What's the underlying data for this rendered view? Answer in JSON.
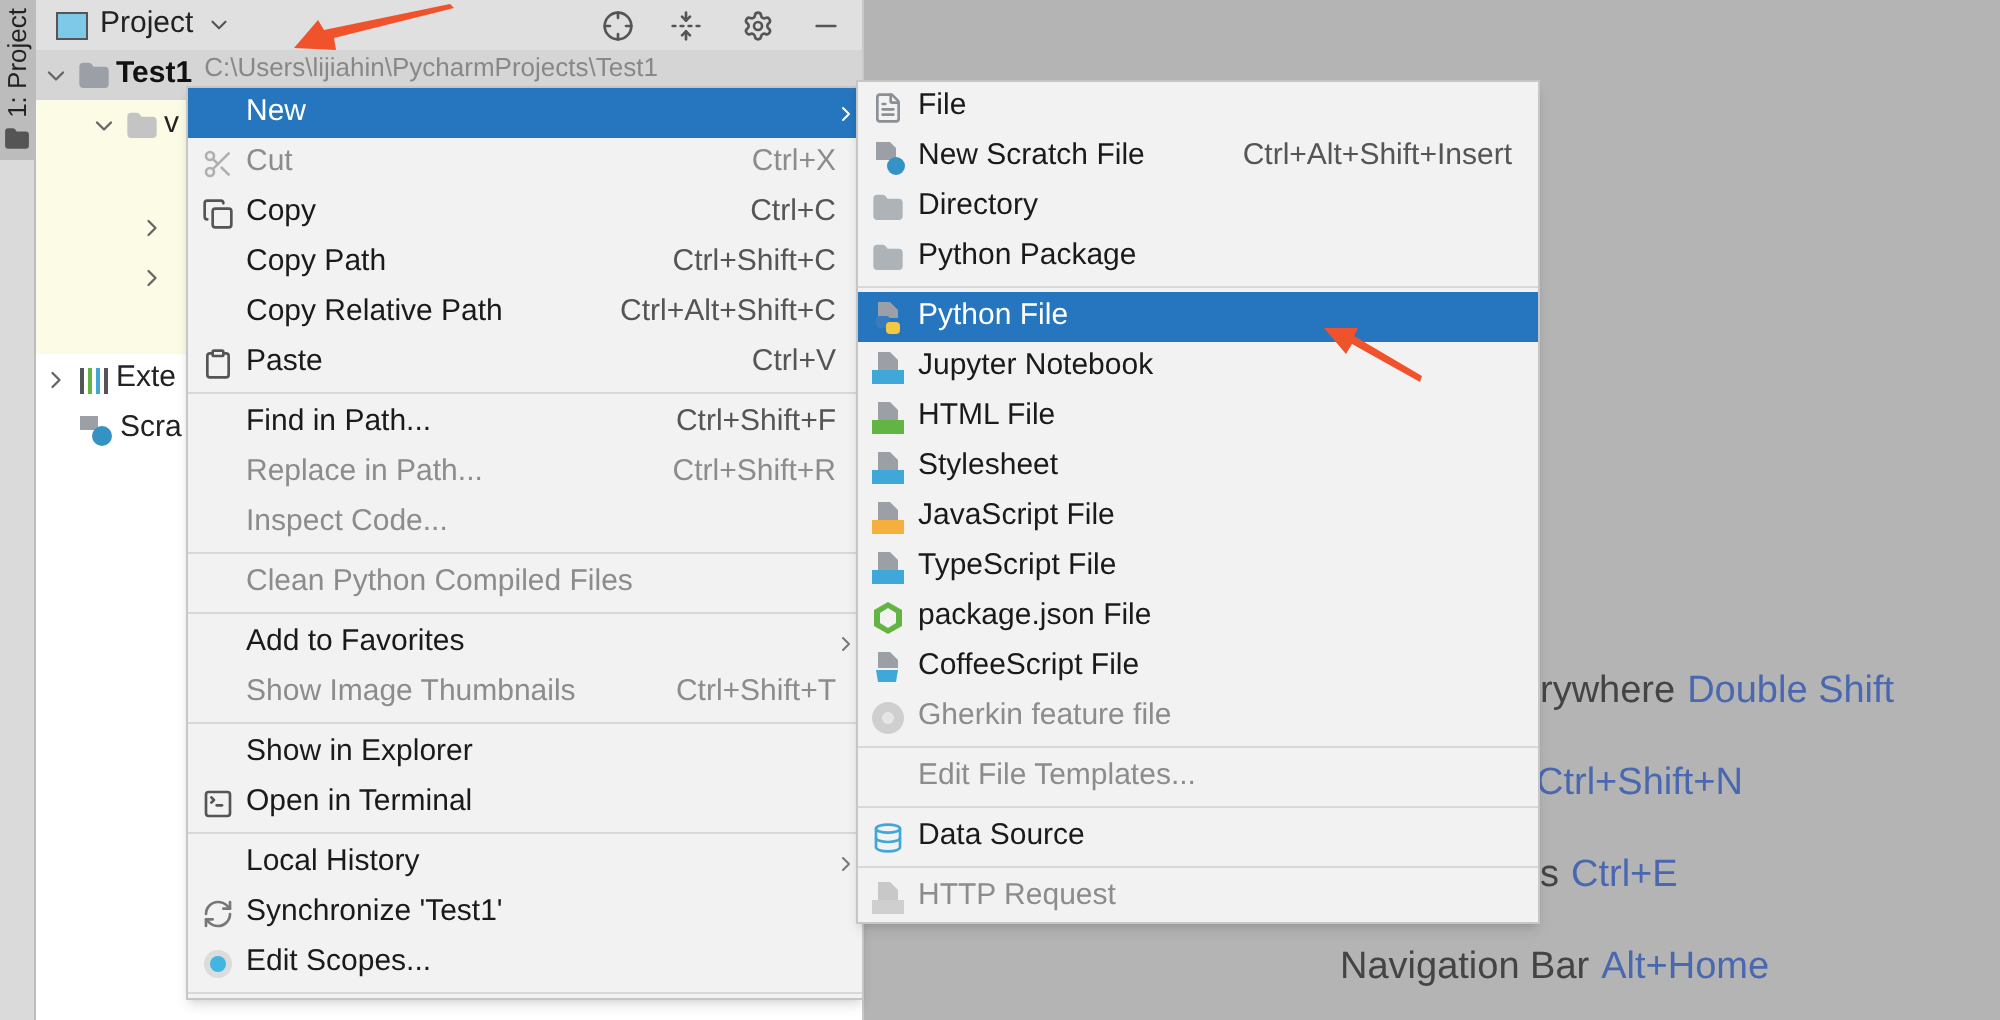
{
  "tool_stripe": {
    "label": "1: Project",
    "selected": true
  },
  "panel": {
    "title": "Project"
  },
  "tree": [
    {
      "kind": "folder",
      "label": "Test1",
      "path": "C:\\Users\\lijiahin\\PycharmProjects\\Test1",
      "expanded": true,
      "selected": true,
      "children": [
        {
          "kind": "excluded-folder",
          "label": "v",
          "expanded": true,
          "children": [
            {
              "expanded": false
            },
            {
              "expanded": false
            }
          ]
        }
      ]
    },
    {
      "kind": "libraries",
      "label": "Exte",
      "expanded": false
    },
    {
      "kind": "scratches",
      "label": "Scra"
    }
  ],
  "context_menu": [
    {
      "kind": "item",
      "label": "New",
      "selected": true,
      "submenu": true,
      "disabled": false
    },
    {
      "kind": "item",
      "label": "Cut",
      "shortcut": "Ctrl+X",
      "disabled": true,
      "selected": false
    },
    {
      "kind": "item",
      "label": "Copy",
      "shortcut": "Ctrl+C",
      "disabled": false,
      "selected": false
    },
    {
      "kind": "item",
      "label": "Copy Path",
      "shortcut": "Ctrl+Shift+C",
      "disabled": false,
      "selected": false
    },
    {
      "kind": "item",
      "label": "Copy Relative Path",
      "shortcut": "Ctrl+Alt+Shift+C",
      "disabled": false,
      "selected": false
    },
    {
      "kind": "item",
      "label": "Paste",
      "shortcut": "Ctrl+V",
      "disabled": false,
      "selected": false
    },
    {
      "kind": "separator"
    },
    {
      "kind": "item",
      "label": "Find in Path...",
      "shortcut": "Ctrl+Shift+F",
      "disabled": false,
      "selected": false
    },
    {
      "kind": "item",
      "label": "Replace in Path...",
      "shortcut": "Ctrl+Shift+R",
      "disabled": true,
      "selected": false
    },
    {
      "kind": "item",
      "label": "Inspect Code...",
      "disabled": true,
      "selected": false
    },
    {
      "kind": "separator"
    },
    {
      "kind": "item",
      "label": "Clean Python Compiled Files",
      "disabled": true,
      "selected": false
    },
    {
      "kind": "separator"
    },
    {
      "kind": "item",
      "label": "Add to Favorites",
      "submenu": true,
      "disabled": false,
      "selected": false
    },
    {
      "kind": "item",
      "label": "Show Image Thumbnails",
      "shortcut": "Ctrl+Shift+T",
      "disabled": true,
      "selected": false
    },
    {
      "kind": "separator"
    },
    {
      "kind": "item",
      "label": "Show in Explorer",
      "disabled": false,
      "selected": false
    },
    {
      "kind": "item",
      "label": "Open in Terminal",
      "disabled": false,
      "selected": false
    },
    {
      "kind": "separator"
    },
    {
      "kind": "item",
      "label": "Local History",
      "submenu": true,
      "disabled": false,
      "selected": false
    },
    {
      "kind": "item",
      "label": "Synchronize 'Test1'",
      "disabled": false,
      "selected": false
    },
    {
      "kind": "item",
      "label": "Edit Scopes...",
      "disabled": false,
      "selected": false
    },
    {
      "kind": "separator"
    }
  ],
  "new_submenu": [
    {
      "kind": "item",
      "label": "File",
      "disabled": false,
      "selected": false
    },
    {
      "kind": "item",
      "label": "New Scratch File",
      "shortcut": "Ctrl+Alt+Shift+Insert",
      "disabled": false,
      "selected": false
    },
    {
      "kind": "item",
      "label": "Directory",
      "disabled": false,
      "selected": false
    },
    {
      "kind": "item",
      "label": "Python Package",
      "disabled": false,
      "selected": false
    },
    {
      "kind": "separator"
    },
    {
      "kind": "item",
      "label": "Python File",
      "disabled": false,
      "selected": true
    },
    {
      "kind": "item",
      "label": "Jupyter Notebook",
      "disabled": false,
      "selected": false
    },
    {
      "kind": "item",
      "label": "HTML File",
      "disabled": false,
      "selected": false
    },
    {
      "kind": "item",
      "label": "Stylesheet",
      "disabled": false,
      "selected": false
    },
    {
      "kind": "item",
      "label": "JavaScript File",
      "disabled": false,
      "selected": false
    },
    {
      "kind": "item",
      "label": "TypeScript File",
      "disabled": false,
      "selected": false
    },
    {
      "kind": "item",
      "label": "package.json File",
      "disabled": false,
      "selected": false
    },
    {
      "kind": "item",
      "label": "CoffeeScript File",
      "disabled": false,
      "selected": false
    },
    {
      "kind": "item",
      "label": "Gherkin feature file",
      "disabled": true,
      "selected": false
    },
    {
      "kind": "separator"
    },
    {
      "kind": "item",
      "label": "Edit File Templates...",
      "disabled": true,
      "selected": false
    },
    {
      "kind": "separator"
    },
    {
      "kind": "item",
      "label": "Data Source",
      "disabled": false,
      "selected": false
    },
    {
      "kind": "separator"
    },
    {
      "kind": "item",
      "label": "HTTP Request",
      "disabled": true,
      "selected": false
    }
  ],
  "editor_hints": [
    {
      "text": "rywhere",
      "shortcut": "Double Shift"
    },
    {
      "shortcut": "Ctrl+Shift+N"
    },
    {
      "text": "s",
      "shortcut": "Ctrl+E"
    },
    {
      "text": "Navigation Bar",
      "shortcut": "Alt+Home"
    }
  ]
}
